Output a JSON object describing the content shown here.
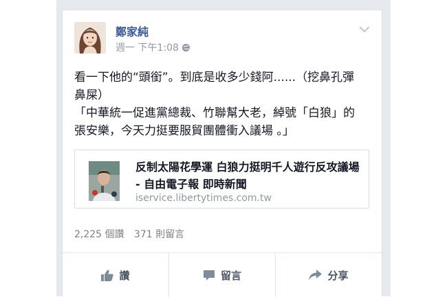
{
  "post": {
    "author": "鄭家純",
    "timestamp": "週一 下午1:08",
    "body_line1": "看一下他的“頭銜”。到底是收多少錢阿......（挖鼻孔彈",
    "body_line2": "鼻屎）",
    "body_line3": "「中華統一促進黨總裁、竹聯幫大老，綽號「白狼」的",
    "body_line4": "張安樂，今天力挺要服貿團體衝入議場 。」"
  },
  "link_preview": {
    "title": "反制太陽花學運 白狼力挺明千人遊行反攻議場 - 自由電子報 即時新聞",
    "domain": "iservice.libertytimes.com.tw"
  },
  "stats": {
    "reads": "2,225 個讚",
    "comments": "371 則留言"
  },
  "actions": {
    "like": "讚",
    "comment": "留言",
    "share": "分享"
  },
  "icons": [
    "globe-icon",
    "chevron-down-icon",
    "thumbs-up-icon",
    "comment-icon",
    "share-icon"
  ],
  "colors": {
    "link_blue": "#3b5998",
    "meta_gray": "#9197a3"
  }
}
